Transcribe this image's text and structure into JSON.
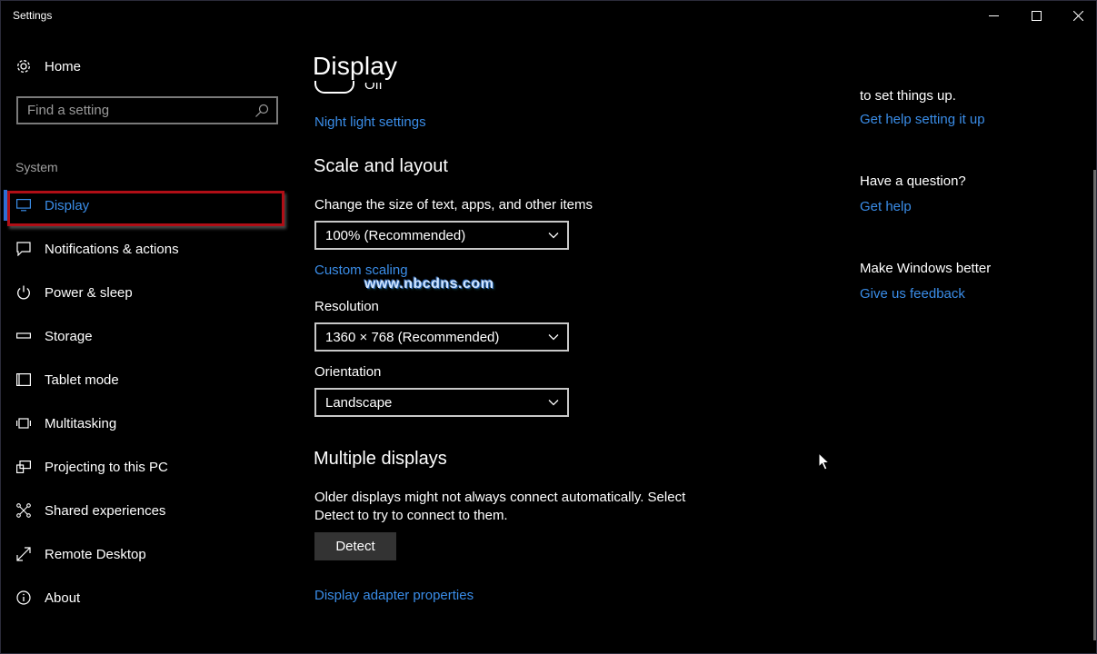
{
  "window": {
    "title": "Settings"
  },
  "sidebar": {
    "home_label": "Home",
    "search_placeholder": "Find a setting",
    "section_label": "System",
    "items": [
      {
        "label": "Display",
        "icon": "monitor-icon",
        "selected": true
      },
      {
        "label": "Notifications & actions",
        "icon": "speech-bubble-icon"
      },
      {
        "label": "Power & sleep",
        "icon": "power-icon"
      },
      {
        "label": "Storage",
        "icon": "storage-drive-icon"
      },
      {
        "label": "Tablet mode",
        "icon": "tablet-icon"
      },
      {
        "label": "Multitasking",
        "icon": "multitasking-icon"
      },
      {
        "label": "Projecting to this PC",
        "icon": "projector-icon"
      },
      {
        "label": "Shared experiences",
        "icon": "share-icon"
      },
      {
        "label": "Remote Desktop",
        "icon": "remote-desktop-icon"
      },
      {
        "label": "About",
        "icon": "info-icon"
      }
    ]
  },
  "main": {
    "title": "Display",
    "toggle_partial_text": "Off",
    "night_light_link": "Night light settings",
    "scale_heading": "Scale and layout",
    "scale_label": "Change the size of text, apps, and other items",
    "scale_value": "100% (Recommended)",
    "custom_scaling_link": "Custom scaling",
    "watermark": "www.nbcdns.com",
    "resolution_label": "Resolution",
    "resolution_value": "1360 × 768 (Recommended)",
    "orientation_label": "Orientation",
    "orientation_value": "Landscape",
    "multiple_heading": "Multiple displays",
    "multiple_text_line1": "Older displays might not always connect automatically. Select",
    "multiple_text_line2": "Detect to try to connect to them.",
    "detect_label": "Detect",
    "adapter_link": "Display adapter properties"
  },
  "right_pane": {
    "partial_text": "to set things up.",
    "help_setup_link": "Get help setting it up",
    "question_heading": "Have a question?",
    "get_help_link": "Get help",
    "better_heading": "Make Windows better",
    "feedback_link": "Give us feedback"
  },
  "colors": {
    "accent": "#3a8de8",
    "selected_indicator": "#2f6fd6",
    "highlight_box": "#b00e16",
    "background": "#000000"
  }
}
